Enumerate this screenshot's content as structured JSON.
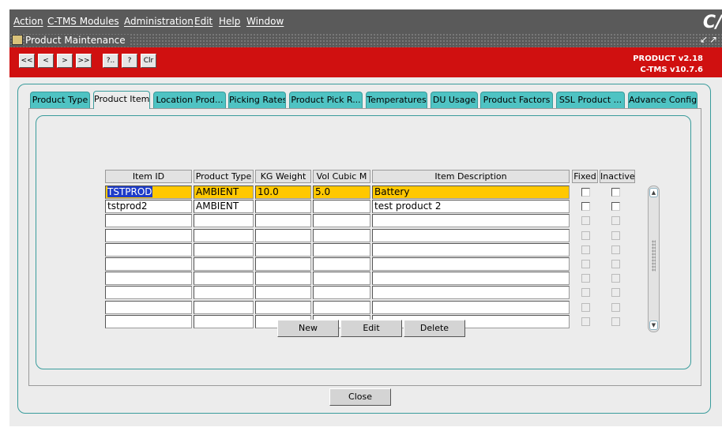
{
  "menubar": {
    "items": [
      "Action",
      "C-TMS Modules",
      "Administration",
      "Edit",
      "Help",
      "Window"
    ],
    "logo": "C/"
  },
  "window": {
    "title": "Product Maintenance",
    "controls": [
      "↙",
      "↗"
    ]
  },
  "toolbar": {
    "nav": [
      "<<",
      "<",
      ">",
      ">>"
    ],
    "actions": [
      "?..",
      "?",
      "Clr"
    ],
    "product_version": "PRODUCT v2.18",
    "ctms_version": "C-TMS v10.7.6"
  },
  "tabs": [
    "Product Type",
    "Product Item",
    "Location Prod...",
    "Picking Rates",
    "Product Pick R...",
    "Temperatures",
    "DU Usage",
    "Product Factors",
    "SSL Product ...",
    "Advance Config"
  ],
  "active_tab": "Product Item",
  "grid": {
    "columns": [
      "Item ID",
      "Product Type",
      "KG Weight",
      "Vol Cubic M",
      "Item Description"
    ],
    "checkbox_columns": [
      "Fixed",
      "Inactive"
    ],
    "rows": [
      [
        "TSTPROD",
        "AMBIENT",
        "10.0",
        "5.0",
        "Battery"
      ],
      [
        "tstprod2",
        "AMBIENT",
        "",
        "",
        "test product 2"
      ],
      [
        "",
        "",
        "",
        "",
        ""
      ],
      [
        "",
        "",
        "",
        "",
        ""
      ],
      [
        "",
        "",
        "",
        "",
        ""
      ],
      [
        "",
        "",
        "",
        "",
        ""
      ],
      [
        "",
        "",
        "",
        "",
        ""
      ],
      [
        "",
        "",
        "",
        "",
        ""
      ],
      [
        "",
        "",
        "",
        "",
        ""
      ],
      [
        "",
        "",
        "",
        "",
        ""
      ]
    ],
    "selected_row": 0
  },
  "buttons": {
    "new": "New",
    "edit": "Edit",
    "delete": "Delete",
    "close": "Close"
  }
}
